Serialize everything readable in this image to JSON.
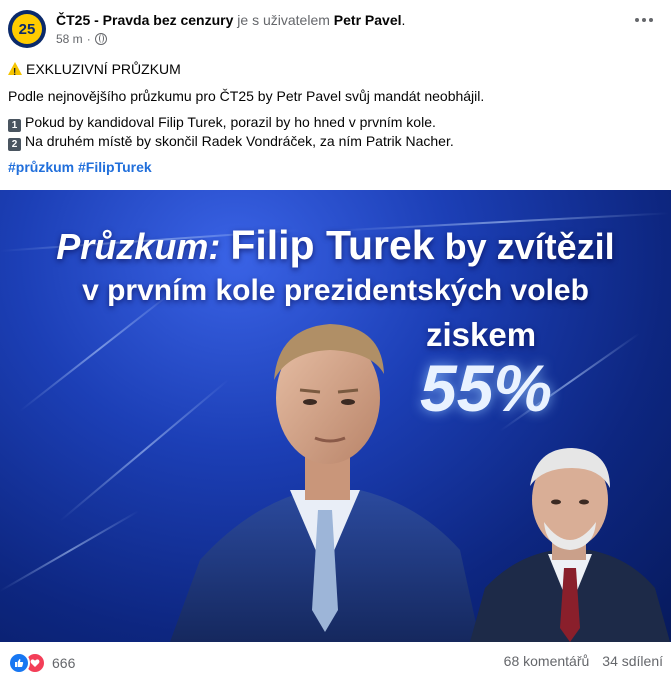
{
  "header": {
    "avatar_text": "25",
    "page_name": "ČT25 - Pravda bez cenzury",
    "with_text": " je s uživatelem ",
    "person": "Petr Pavel",
    "period": ".",
    "time": "58 m",
    "separator": "·"
  },
  "body": {
    "line1": "EXKLUZIVNÍ PRŮZKUM",
    "line2": "Podle nejnovějšího průzkumu pro ČT25 by Petr Pavel svůj mandát neobhájil.",
    "item1_num": "1",
    "item1": "Pokud by kandidoval Filip Turek, porazil by ho hned v prvním kole.",
    "item2_num": "2",
    "item2": "Na druhém místě by skončil Radek Vondráček, za ním Patrik Nacher.",
    "hashtags": "#průzkum #FilipTurek"
  },
  "image": {
    "title_prefix": "Průzkum:",
    "title_name": "Filip Turek",
    "title_rest": "by zvítězil",
    "line2": "v prvním kole prezidentských voleb",
    "ziskem": "ziskem",
    "percent": "55%"
  },
  "footer": {
    "reaction_count": "666",
    "comments": "68 komentářů",
    "shares": "34 sdílení"
  },
  "colors": {
    "link": "#216fdb",
    "like": "#1877f2",
    "love": "#f33e58",
    "brand_yellow": "#ffcc00",
    "brand_navy": "#0b2a6b"
  }
}
